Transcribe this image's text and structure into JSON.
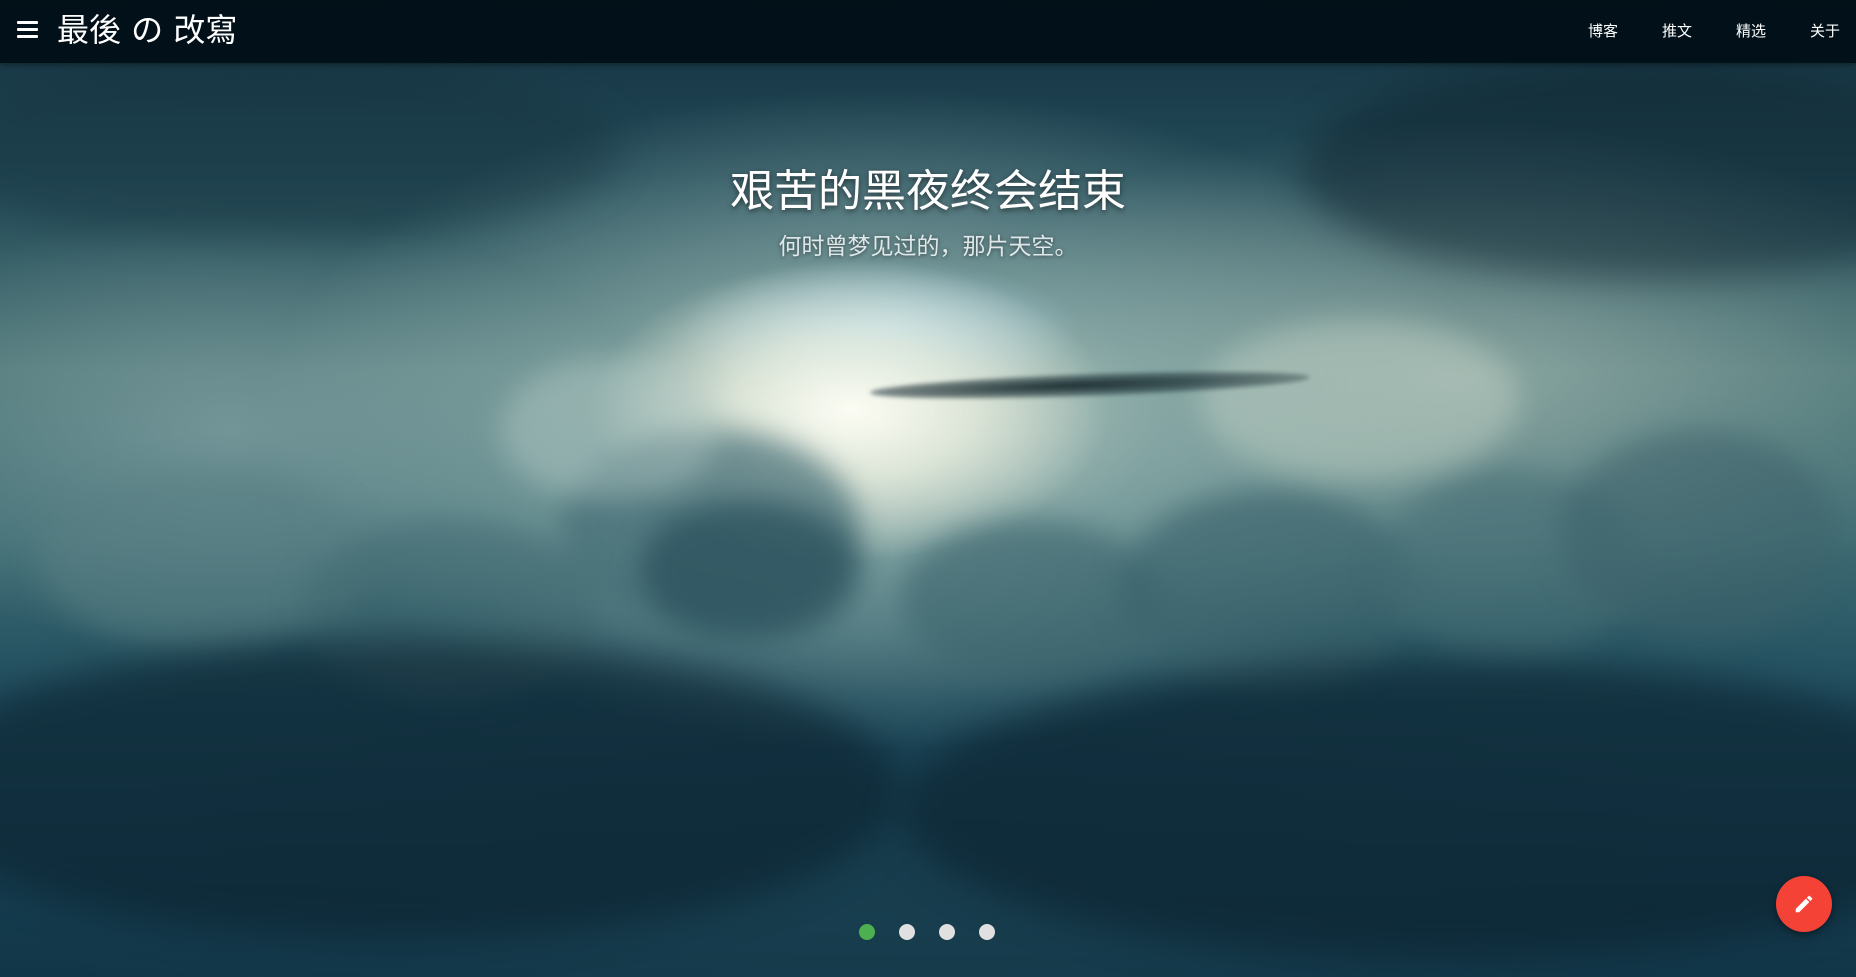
{
  "header": {
    "title": "最後 の 改寫",
    "menu_icon": "menu-icon",
    "nav_items": [
      {
        "label": "博客"
      },
      {
        "label": "推文"
      },
      {
        "label": "精选"
      },
      {
        "label": "关于"
      }
    ]
  },
  "hero": {
    "title": "艰苦的黑夜终会结束",
    "subtitle": "何时曾梦见过的，那片天空。",
    "background": "cloud-sky-image"
  },
  "carousel": {
    "slide_count": 4,
    "active_index": 0,
    "active_color": "#4caf50",
    "inactive_color": "#e0e0e0"
  },
  "fab": {
    "icon": "pencil-icon",
    "color": "#f44336"
  },
  "colors": {
    "navbar": "#010e16",
    "sky_dark": "#14303f",
    "sky_light": "#eef2e2"
  }
}
